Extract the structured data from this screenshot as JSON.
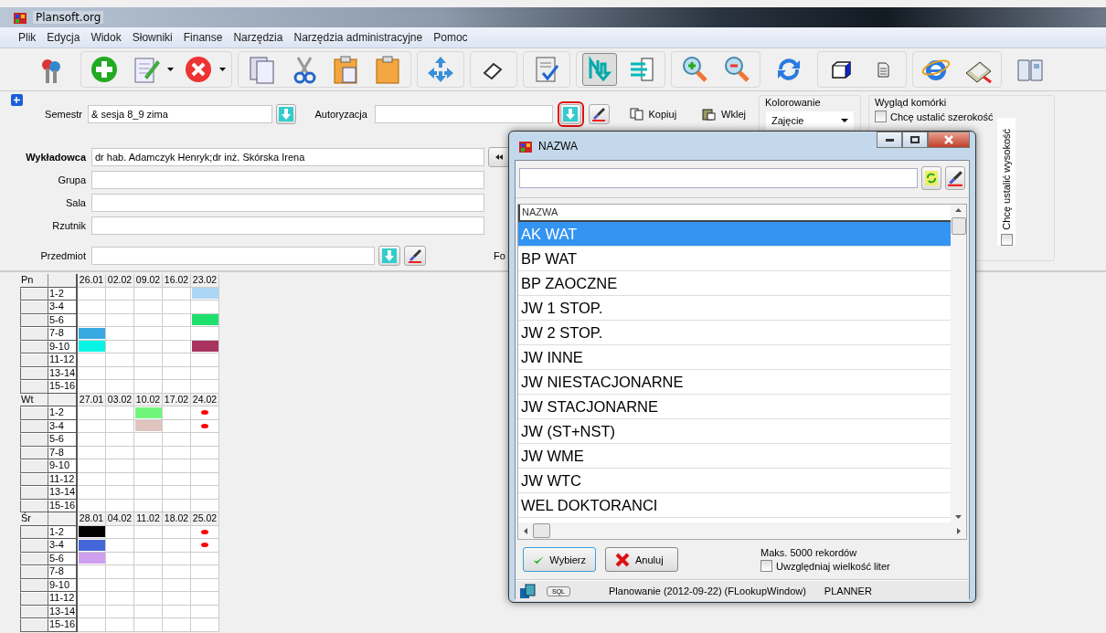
{
  "window": {
    "title": "Plansoft.org"
  },
  "menu": [
    "Plik",
    "Edycja",
    "Widok",
    "Słowniki",
    "Finanse",
    "Narzędzia",
    "Narzędzia administracyjne",
    "Pomoc"
  ],
  "toolbar": [
    {
      "kind": "single",
      "buttons": [
        {
          "kind": "plain",
          "pressed": false
        }
      ]
    },
    {
      "kind": "group",
      "buttons": [
        {
          "kind": "plain",
          "pressed": false
        },
        {
          "kind": "split",
          "pressed": false
        },
        {
          "kind": "split",
          "pressed": false
        }
      ]
    },
    {
      "kind": "group",
      "buttons": [
        {
          "kind": "plain",
          "pressed": false
        },
        {
          "kind": "plain",
          "pressed": false
        },
        {
          "kind": "plain",
          "pressed": false
        },
        {
          "kind": "plain",
          "pressed": false
        }
      ]
    },
    {
      "kind": "group",
      "buttons": [
        {
          "kind": "plain",
          "pressed": false
        }
      ]
    },
    {
      "kind": "group",
      "buttons": [
        {
          "kind": "plain",
          "pressed": false
        }
      ]
    },
    {
      "kind": "group",
      "buttons": [
        {
          "kind": "plain",
          "pressed": false
        }
      ]
    },
    {
      "kind": "group",
      "buttons": [
        {
          "kind": "plain",
          "pressed": true
        },
        {
          "kind": "plain",
          "pressed": false
        }
      ]
    },
    {
      "kind": "group",
      "buttons": [
        {
          "kind": "plain",
          "pressed": false
        },
        {
          "kind": "plain",
          "pressed": false
        }
      ]
    },
    {
      "kind": "single",
      "buttons": [
        {
          "kind": "plain",
          "pressed": false
        }
      ]
    },
    {
      "kind": "group",
      "buttons": [
        {
          "kind": "plain",
          "pressed": false
        },
        {
          "kind": "plain",
          "pressed": false
        }
      ]
    },
    {
      "kind": "group",
      "buttons": [
        {
          "kind": "plain",
          "pressed": false
        },
        {
          "kind": "plain",
          "pressed": false
        }
      ]
    },
    {
      "kind": "single",
      "buttons": [
        {
          "kind": "plain",
          "pressed": false
        }
      ]
    }
  ],
  "form": {
    "semestr": {
      "label": "Semestr",
      "value": "& sesja 8_9 zima"
    },
    "autoryzacja": {
      "label": "Autoryzacja",
      "highlighted": true
    },
    "kopiuj": "Kopiuj",
    "wklej": "Wklej",
    "coloring": {
      "title": "Kolorowanie",
      "value": "Zajęcie"
    },
    "cell_look": {
      "title": "Wygląd komórki",
      "width_label": "Chcę ustalić szerokość",
      "width_checked": false,
      "height_label": "Chcę ustalić wysokość",
      "height_checked": false
    },
    "fields": [
      {
        "label": "Wykładowca",
        "value": "dr hab. Adamczyk Henryk;dr inż. Skórska Irena",
        "bold": true,
        "kind": "back"
      },
      {
        "label": "Grupa",
        "bold": false,
        "kind": "plain"
      },
      {
        "label": "Sala",
        "bold": false,
        "kind": "plain"
      },
      {
        "label": "Rzutnik",
        "bold": false,
        "kind": "plain"
      }
    ],
    "przedmiot": {
      "label": "Przedmiot"
    },
    "cut_label": "Fo"
  },
  "schedule": [
    {
      "day": "Pn",
      "dates": [
        "26.01",
        "02.02",
        "09.02",
        "16.02",
        "23.02"
      ],
      "slots": [
        {
          "label": "1-2",
          "cells": [
            null,
            null,
            null,
            null,
            {
              "kind": "block",
              "color": "#acd6f5"
            }
          ]
        },
        {
          "label": "3-4",
          "cells": [
            null,
            null,
            null,
            null,
            null
          ]
        },
        {
          "label": "5-6",
          "cells": [
            null,
            null,
            null,
            null,
            {
              "kind": "block",
              "color": "#1ee06e"
            }
          ]
        },
        {
          "label": "7-8",
          "cells": [
            {
              "kind": "block",
              "color": "#38a8e0"
            },
            null,
            null,
            null,
            null
          ]
        },
        {
          "label": "9-10",
          "cells": [
            {
              "kind": "block",
              "color": "#08f5e5"
            },
            null,
            null,
            null,
            {
              "kind": "block",
              "color": "#a8335f"
            }
          ]
        },
        {
          "label": "11-12",
          "cells": [
            null,
            null,
            null,
            null,
            null
          ]
        },
        {
          "label": "13-14",
          "cells": [
            null,
            null,
            null,
            null,
            null
          ]
        },
        {
          "label": "15-16",
          "cells": [
            null,
            null,
            null,
            null,
            null
          ]
        }
      ]
    },
    {
      "day": "Wt",
      "dates": [
        "27.01",
        "03.02",
        "10.02",
        "17.02",
        "24.02"
      ],
      "slots": [
        {
          "label": "1-2",
          "cells": [
            null,
            null,
            {
              "kind": "block",
              "color": "#70f57a"
            },
            null,
            {
              "kind": "dot",
              "color": "#ff0000"
            }
          ]
        },
        {
          "label": "3-4",
          "cells": [
            null,
            null,
            {
              "kind": "block",
              "color": "#dfc3bc"
            },
            null,
            {
              "kind": "dot",
              "color": "#ff0000"
            }
          ]
        },
        {
          "label": "5-6",
          "cells": [
            null,
            null,
            null,
            null,
            null
          ]
        },
        {
          "label": "7-8",
          "cells": [
            null,
            null,
            null,
            null,
            null
          ]
        },
        {
          "label": "9-10",
          "cells": [
            null,
            null,
            null,
            null,
            null
          ]
        },
        {
          "label": "11-12",
          "cells": [
            null,
            null,
            null,
            null,
            null
          ]
        },
        {
          "label": "13-14",
          "cells": [
            null,
            null,
            null,
            null,
            null
          ]
        },
        {
          "label": "15-16",
          "cells": [
            null,
            null,
            null,
            null,
            null
          ]
        }
      ]
    },
    {
      "day": "Śr",
      "dates": [
        "28.01",
        "04.02",
        "11.02",
        "18.02",
        "25.02"
      ],
      "slots": [
        {
          "label": "1-2",
          "cells": [
            {
              "kind": "block",
              "color": "#000000"
            },
            null,
            null,
            null,
            {
              "kind": "dot",
              "color": "#ff0000"
            }
          ]
        },
        {
          "label": "3-4",
          "cells": [
            {
              "kind": "block",
              "color": "#4466d8"
            },
            null,
            null,
            null,
            {
              "kind": "dot",
              "color": "#ff0000"
            }
          ]
        },
        {
          "label": "5-6",
          "cells": [
            {
              "kind": "block",
              "color": "#d0a0f0"
            },
            null,
            null,
            null,
            null
          ]
        },
        {
          "label": "7-8",
          "cells": [
            null,
            null,
            null,
            null,
            null
          ]
        },
        {
          "label": "9-10",
          "cells": [
            null,
            null,
            null,
            null,
            null
          ]
        },
        {
          "label": "11-12",
          "cells": [
            null,
            null,
            null,
            null,
            null
          ]
        },
        {
          "label": "13-14",
          "cells": [
            null,
            null,
            null,
            null,
            null
          ]
        },
        {
          "label": "15-16",
          "cells": [
            null,
            null,
            null,
            null,
            null
          ]
        }
      ]
    }
  ],
  "dialog": {
    "title": "NAZWA",
    "column": "NAZWA",
    "items": [
      {
        "label": "AK WAT",
        "selected": true
      },
      {
        "label": "BP WAT",
        "selected": false
      },
      {
        "label": "BP ZAOCZNE",
        "selected": false
      },
      {
        "label": "JW 1 STOP.",
        "selected": false
      },
      {
        "label": "JW 2 STOP.",
        "selected": false
      },
      {
        "label": "JW INNE",
        "selected": false
      },
      {
        "label": "JW NIESTACJONARNE",
        "selected": false
      },
      {
        "label": "JW STACJONARNE",
        "selected": false
      },
      {
        "label": "JW (ST+NST)",
        "selected": false
      },
      {
        "label": "JW WME",
        "selected": false
      },
      {
        "label": "JW WTC",
        "selected": false
      },
      {
        "label": "WEL DOKTORANCI",
        "selected": false
      }
    ],
    "ok": "Wybierz",
    "cancel": "Anuluj",
    "max": "Maks. 5000 rekordów",
    "case_label": "Uwzględniaj wielkość liter",
    "case_checked": false,
    "sql": "SQL",
    "status": "Planowanie (2012-09-22) (FLookupWindow)",
    "user": "PLANNER"
  }
}
